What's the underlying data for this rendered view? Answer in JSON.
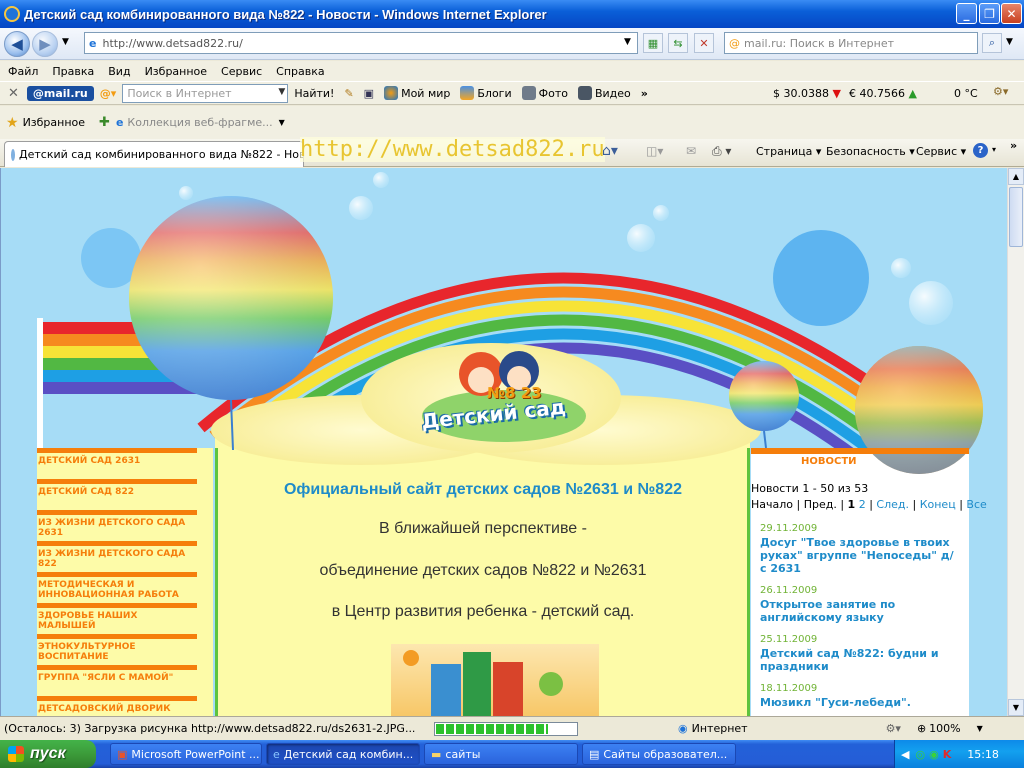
{
  "window": {
    "title": "Детский сад комбинированного вида №822 - Новости - Windows Internet Explorer",
    "minimize": "_",
    "maximize": "❐",
    "close": "✕"
  },
  "address_bar": {
    "url": "http://www.detsad822.ru/",
    "search_placeholder": "mail.ru: Поиск в Интернет"
  },
  "menu": [
    "Файл",
    "Правка",
    "Вид",
    "Избранное",
    "Сервис",
    "Справка"
  ],
  "mail_toolbar": {
    "logo": "@mail.ru",
    "search_placeholder": "Поиск в Интернет",
    "find_label": "Найти!",
    "buttons": [
      "Мой мир",
      "Блоги",
      "Фото",
      "Видео"
    ],
    "usd": "$ 30.0388",
    "eur": "€ 40.7566",
    "temp": "0 °C"
  },
  "favorites_bar": {
    "favorites_label": "Избранное",
    "collection_label": "Коллекция веб-фрагме..."
  },
  "tabs": {
    "active_tab": "Детский сад комбинированного вида №822 - Ново...",
    "overlay_url": "http://www.detsad822.ru"
  },
  "command_bar": [
    "Страница",
    "Безопасность",
    "Сервис"
  ],
  "page": {
    "logo_number": "№8 23",
    "logo_text": "Детский сад",
    "left_nav": [
      "ДЕТСКИЙ САД 2631",
      "ДЕТСКИЙ САД 822",
      "ИЗ ЖИЗНИ ДЕТСКОГО САДА 2631",
      "ИЗ ЖИЗНИ ДЕТСКОГО САДА 822",
      "МЕТОДИЧЕСКАЯ И ИННОВАЦИОННАЯ РАБОТА",
      "ЗДОРОВЬЕ НАШИХ МАЛЫШЕЙ",
      "ЭТНОКУЛЬТУРНОЕ ВОСПИТАНИЕ",
      "ГРУППА \"ЯСЛИ С МАМОЙ\"",
      "ДЕТСАДОВСКИЙ ДВОРИК"
    ],
    "heading": "Официальный сайт детских садов №2631 и №822",
    "lines": [
      "В ближайшей перспективе -",
      "объединение детских садов №822 и №2631",
      "в Центр развития ребенка - детский сад."
    ],
    "news_header": "НОВОСТИ",
    "news_count": "Новости 1 - 50 из 53",
    "pager": {
      "start": "Начало",
      "prev": "Пред.",
      "page1": "1",
      "page2": "2",
      "next": "След.",
      "end": "Конец",
      "all": "Все"
    },
    "news": [
      {
        "date": "29.11.2009",
        "title": "Досуг \"Твое здоровье в твоих руках\" вгруппе \"Непоседы\" д/с 2631"
      },
      {
        "date": "26.11.2009",
        "title": "Открытое занятие по английскому языку"
      },
      {
        "date": "25.11.2009",
        "title": "Детский сад №822: будни и праздники"
      },
      {
        "date": "18.11.2009",
        "title": "Мюзикл \"Гуси-лебеди\"."
      }
    ]
  },
  "status": {
    "text": "(Осталось: 3) Загрузка рисунка http://www.detsad822.ru/ds2631-2.JPG...",
    "progress": 0.8,
    "zone": "Интернет",
    "zoom": "100%"
  },
  "taskbar": {
    "start": "пуск",
    "tasks": [
      "Microsoft PowerPoint ...",
      "Детский сад комбин...",
      "сайты",
      "Сайты образовател..."
    ],
    "lang": "RU",
    "clock": "15:18"
  }
}
